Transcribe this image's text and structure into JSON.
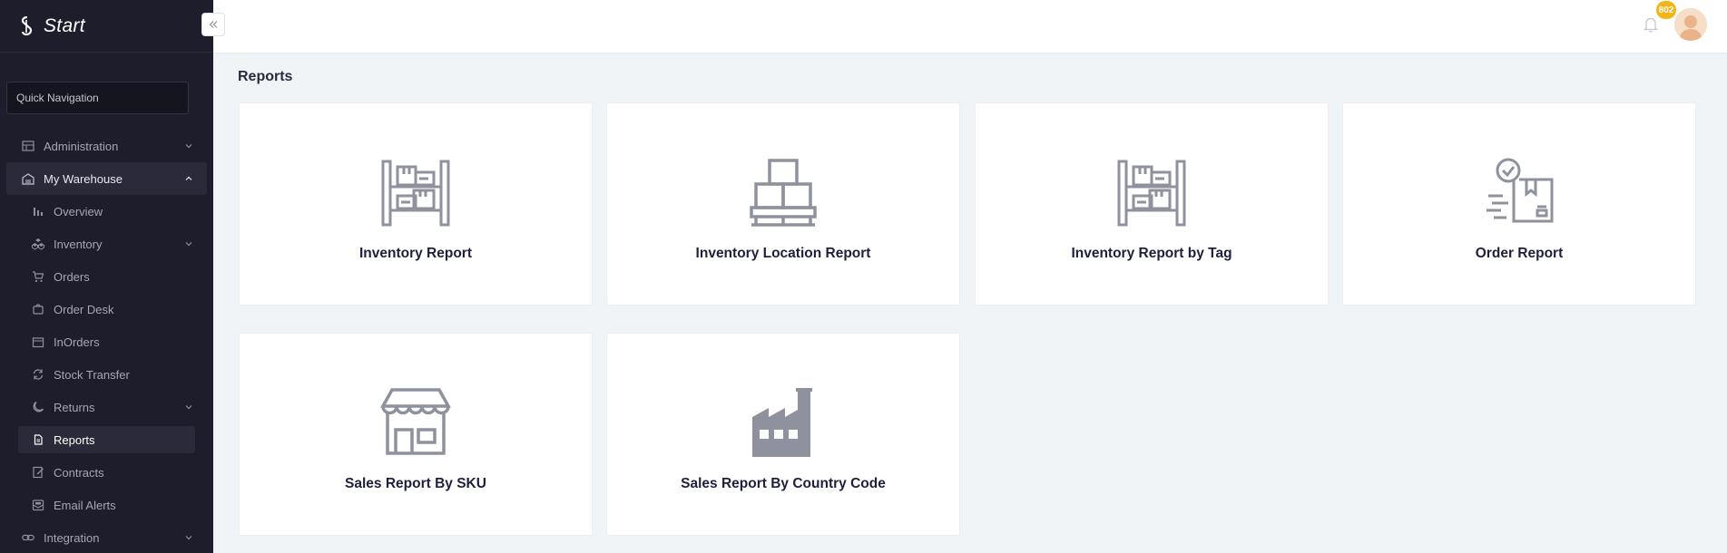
{
  "brand": {
    "title": "Start"
  },
  "quick_nav": {
    "placeholder": "Quick Navigation"
  },
  "nav": {
    "administration": "Administration",
    "my_warehouse": "My Warehouse",
    "overview": "Overview",
    "inventory": "Inventory",
    "orders": "Orders",
    "order_desk": "Order Desk",
    "inorders": "InOrders",
    "stock_transfer": "Stock Transfer",
    "returns": "Returns",
    "reports": "Reports",
    "contracts": "Contracts",
    "email_alerts": "Email Alerts",
    "integration": "Integration"
  },
  "header": {
    "notification_count": "802"
  },
  "page": {
    "title": "Reports"
  },
  "reports": {
    "inventory_report": "Inventory Report",
    "inventory_location_report": "Inventory Location Report",
    "inventory_report_by_tag": "Inventory Report by Tag",
    "order_report": "Order Report",
    "sales_report_by_sku": "Sales Report By SKU",
    "sales_report_by_country_code": "Sales Report By Country Code"
  },
  "colors": {
    "sidebar_bg": "#1d1d2b",
    "icon_gray": "#8f929e",
    "badge": "#f3b516",
    "page_bg": "#f1f4f7"
  }
}
